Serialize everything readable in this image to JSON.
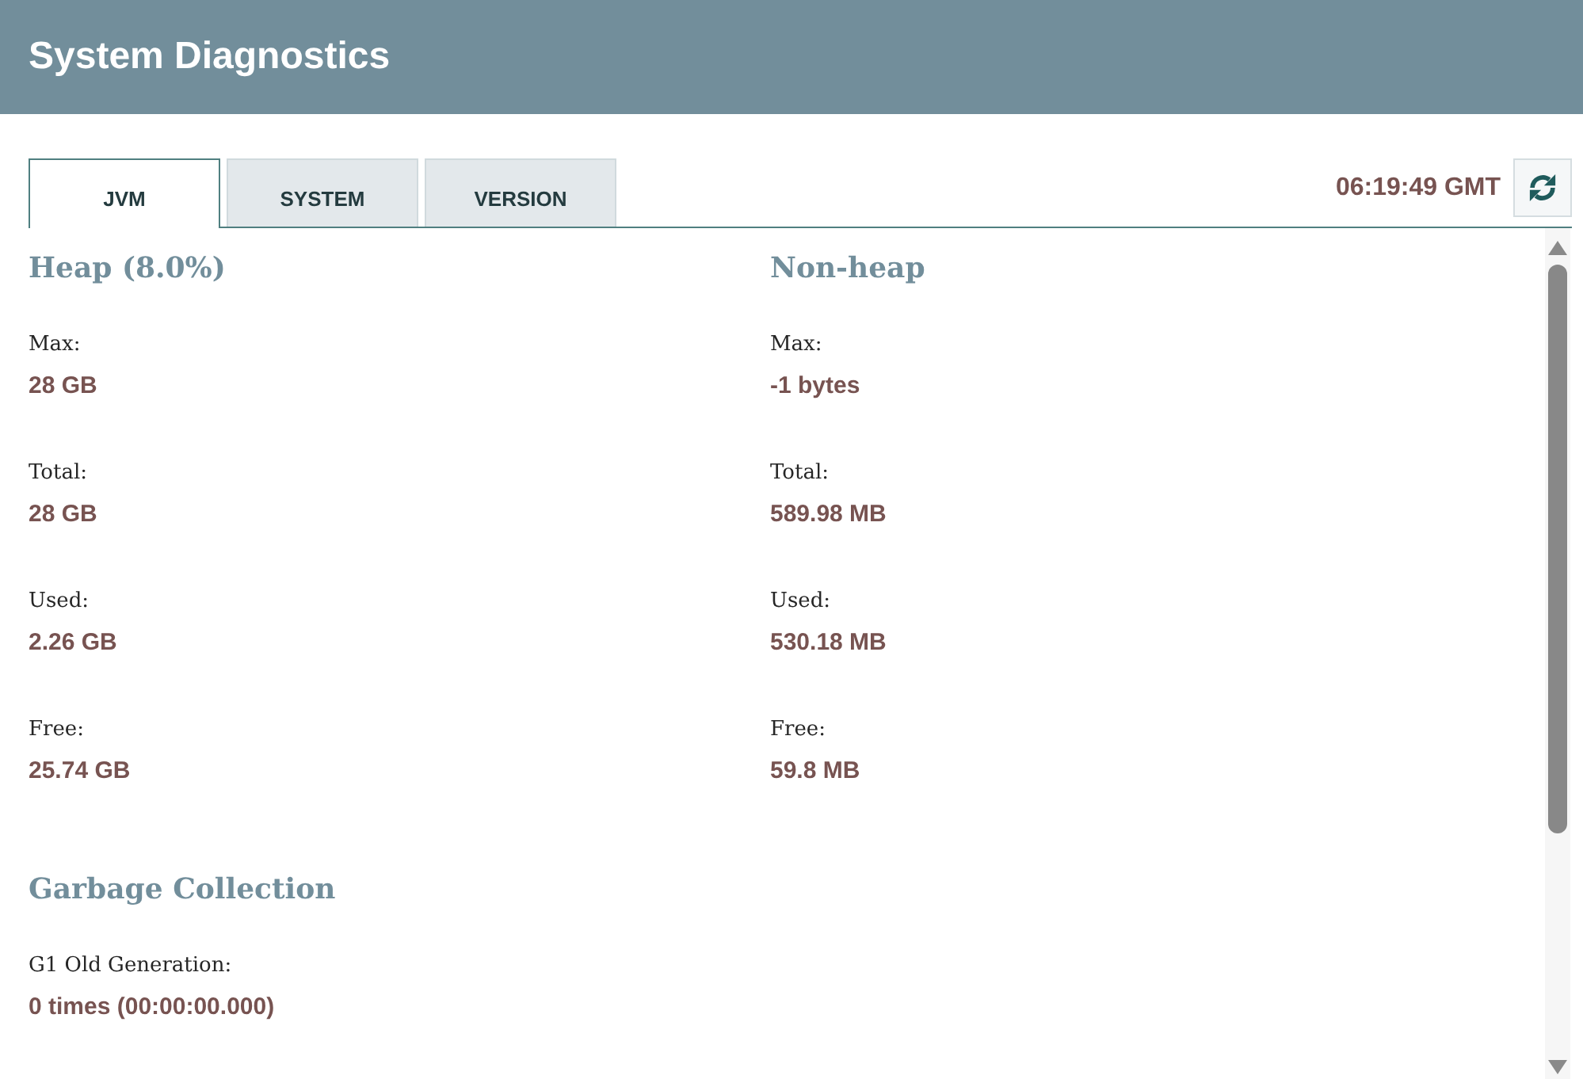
{
  "header": {
    "title": "System Diagnostics"
  },
  "tabs": [
    {
      "label": "JVM",
      "selected": true
    },
    {
      "label": "SYSTEM",
      "selected": false
    },
    {
      "label": "VERSION",
      "selected": false
    }
  ],
  "timestamp": "06:19:49 GMT",
  "memory": [
    {
      "title": "Heap (8.0%)",
      "stats": [
        {
          "label": "Max:",
          "value": "28 GB"
        },
        {
          "label": "Total:",
          "value": "28 GB"
        },
        {
          "label": "Used:",
          "value": "2.26 GB"
        },
        {
          "label": "Free:",
          "value": "25.74 GB"
        }
      ]
    },
    {
      "title": "Non-heap",
      "stats": [
        {
          "label": "Max:",
          "value": "-1 bytes"
        },
        {
          "label": "Total:",
          "value": "589.98 MB"
        },
        {
          "label": "Used:",
          "value": "530.18 MB"
        },
        {
          "label": "Free:",
          "value": "59.8 MB"
        }
      ]
    }
  ],
  "garbage_collection": {
    "title": "Garbage Collection",
    "stats": [
      {
        "label": "G1 Old Generation:",
        "value": "0 times (00:00:00.000)"
      }
    ]
  }
}
